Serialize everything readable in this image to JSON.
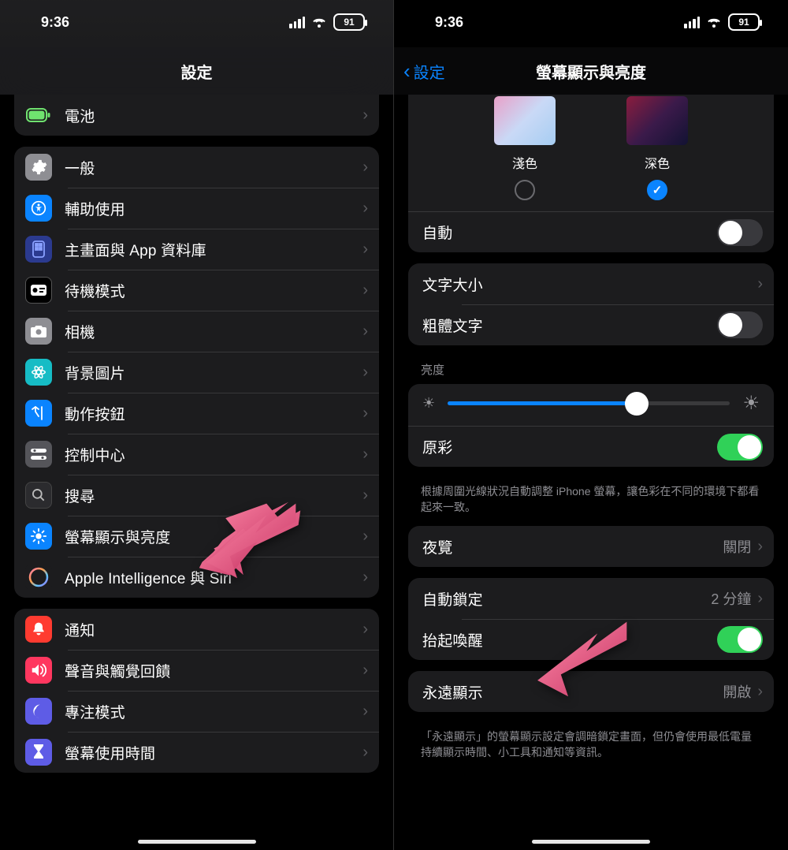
{
  "status": {
    "time": "9:36",
    "battery": "91"
  },
  "left": {
    "title": "設定",
    "group0": [
      {
        "id": "battery",
        "label": "電池",
        "iconColor": "#6fe26f"
      }
    ],
    "group1": [
      {
        "id": "general",
        "label": "一般",
        "bg": "#8e8e93"
      },
      {
        "id": "accessibility",
        "label": "輔助使用",
        "bg": "#0a84ff"
      },
      {
        "id": "homescreen",
        "label": "主畫面與 App 資料庫",
        "bg": "#2b3a8f"
      },
      {
        "id": "standby",
        "label": "待機模式",
        "bg": "#000",
        "border": "#fff"
      },
      {
        "id": "camera",
        "label": "相機",
        "bg": "#8e8e93"
      },
      {
        "id": "wallpaper",
        "label": "背景圖片",
        "bg": "#16bcc5"
      },
      {
        "id": "action",
        "label": "動作按鈕",
        "bg": "#0a84ff"
      },
      {
        "id": "control",
        "label": "控制中心",
        "bg": "#55555a"
      },
      {
        "id": "search",
        "label": "搜尋",
        "bg": "#2b2b2e"
      },
      {
        "id": "display",
        "label": "螢幕顯示與亮度",
        "bg": "#0a84ff"
      },
      {
        "id": "siri",
        "label": "Apple Intelligence 與 Siri",
        "bg": "grad"
      }
    ],
    "group2": [
      {
        "id": "notif",
        "label": "通知",
        "bg": "#ff3b30"
      },
      {
        "id": "sound",
        "label": "聲音與觸覺回饋",
        "bg": "#ff375f"
      },
      {
        "id": "focus",
        "label": "專注模式",
        "bg": "#5e5ce6"
      },
      {
        "id": "screentime",
        "label": "螢幕使用時間",
        "bg": "#5e5ce6"
      }
    ]
  },
  "right": {
    "back": "設定",
    "title": "螢幕顯示與亮度",
    "apprLight": "淺色",
    "apprDark": "深色",
    "auto": "自動",
    "textSize": "文字大小",
    "bold": "粗體文字",
    "brightnessHeader": "亮度",
    "brightnessPct": 67,
    "trueTone": "原彩",
    "trueToneFooter": "根據周圍光線狀況自動調整 iPhone 螢幕，讓色彩在不同的環境下都看起來一致。",
    "nightShift": "夜覽",
    "nightShiftVal": "關閉",
    "autoLock": "自動鎖定",
    "autoLockVal": "2 分鐘",
    "raiseToWake": "抬起喚醒",
    "alwaysOn": "永遠顯示",
    "alwaysOnVal": "開啟",
    "alwaysOnFooter": "「永遠顯示」的螢幕顯示設定會調暗鎖定畫面，但仍會使用最低電量持續顯示時間、小工具和通知等資訊。"
  }
}
